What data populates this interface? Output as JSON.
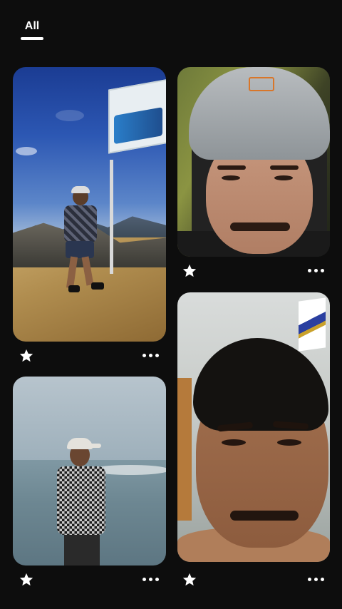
{
  "tabs": {
    "active_label": "All"
  },
  "photos": [
    {
      "name": "mountain-summit-photo",
      "icons": {
        "favorite": "star-icon",
        "more": "more-dots-icon"
      }
    },
    {
      "name": "grey-cap-selfie-photo",
      "icons": {
        "favorite": "star-icon",
        "more": "more-dots-icon"
      }
    },
    {
      "name": "seaside-photo",
      "icons": {
        "favorite": "star-icon",
        "more": "more-dots-icon"
      }
    },
    {
      "name": "room-selfie-photo",
      "icons": {
        "favorite": "star-icon",
        "more": "more-dots-icon"
      }
    }
  ],
  "colors": {
    "background": "#0d0d0d",
    "icon": "#ffffff"
  }
}
